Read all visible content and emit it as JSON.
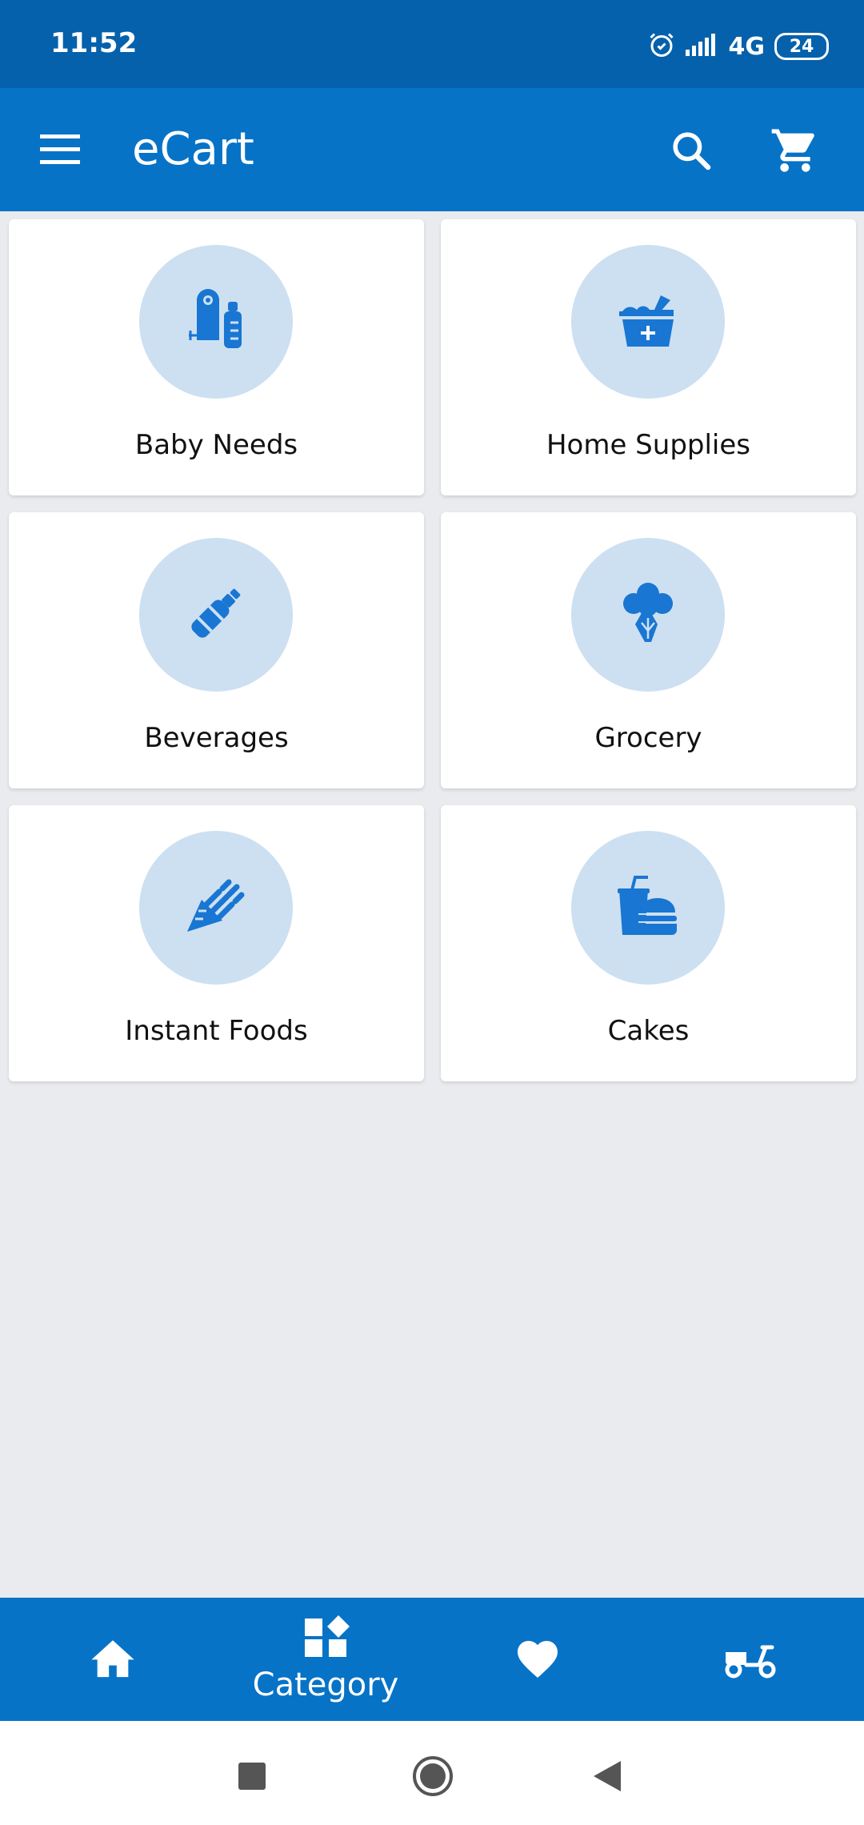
{
  "status_bar": {
    "time": "11:52",
    "network": "4G",
    "battery": "24"
  },
  "app_bar": {
    "title": "eCart",
    "icons": [
      "menu-icon",
      "search-icon",
      "cart-icon"
    ]
  },
  "categories": [
    {
      "label": "Baby Needs",
      "icon": "baby-needs-icon"
    },
    {
      "label": "Home Supplies",
      "icon": "home-supplies-icon"
    },
    {
      "label": "Beverages",
      "icon": "bottle-icon"
    },
    {
      "label": "Grocery",
      "icon": "broccoli-icon"
    },
    {
      "label": "Instant Foods",
      "icon": "ice-cream-cone-icon"
    },
    {
      "label": "Cakes",
      "icon": "fast-food-icon"
    }
  ],
  "bottom_nav": {
    "active": "Category",
    "items": [
      {
        "id": "home",
        "icon": "home-icon",
        "label": ""
      },
      {
        "id": "category",
        "icon": "category-icon",
        "label": "Category"
      },
      {
        "id": "favorites",
        "icon": "heart-icon",
        "label": ""
      },
      {
        "id": "orders",
        "icon": "scooter-icon",
        "label": ""
      }
    ]
  },
  "colors": {
    "primary": "#0673c7",
    "status_bar": "#0561ac",
    "icon_circle": "#cde0f1",
    "icon": "#1976d2",
    "background": "#eaebee"
  }
}
